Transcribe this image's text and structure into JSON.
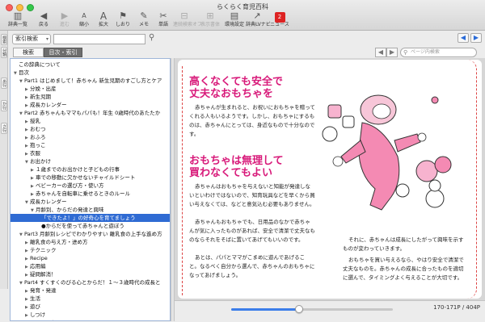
{
  "window": {
    "title": "らくらく育児百科"
  },
  "toolbar": {
    "buttons": [
      {
        "label": "辞典一覧",
        "icon": "book-list-icon",
        "glyph": "▥",
        "enabled": true
      },
      {
        "label": "戻る",
        "icon": "back-icon",
        "glyph": "◀",
        "enabled": true
      },
      {
        "label": "進む",
        "icon": "forward-icon",
        "glyph": "▶",
        "enabled": false
      },
      {
        "label": "縮小",
        "icon": "zoom-out-icon",
        "glyph": "A",
        "enabled": true
      },
      {
        "label": "拡大",
        "icon": "zoom-in-icon",
        "glyph": "A",
        "enabled": true
      },
      {
        "label": "しおり",
        "icon": "bookmark-icon",
        "glyph": "⚑",
        "enabled": true
      },
      {
        "label": "メモ",
        "icon": "memo-icon",
        "glyph": "✎",
        "enabled": true
      },
      {
        "label": "単語",
        "icon": "word-icon",
        "glyph": "✂",
        "enabled": true
      },
      {
        "label": "連続検索オフ",
        "icon": "continuous-search-icon",
        "glyph": "⊟",
        "enabled": false
      },
      {
        "label": "表示書体",
        "icon": "font-icon",
        "glyph": "⊞",
        "enabled": false
      },
      {
        "label": "環境設定",
        "icon": "settings-icon",
        "glyph": "▤",
        "enabled": true
      },
      {
        "label": "辞典LVナビ",
        "icon": "navi-icon",
        "glyph": "↗",
        "enabled": true
      },
      {
        "label": "ニュース",
        "icon": "news-icon",
        "glyph": "2",
        "enabled": true
      }
    ]
  },
  "search": {
    "mode": "索引検索",
    "query": ""
  },
  "tabs": {
    "search": "検索",
    "index": "目次・索引"
  },
  "page_search": {
    "placeholder": "ページ内検索"
  },
  "side_tabs": [
    "検索",
    "分類",
    "あ行",
    "か行",
    "さ行"
  ],
  "tree": [
    {
      "level": 0,
      "arrow": "",
      "text": "この辞典について",
      "selected": false
    },
    {
      "level": 0,
      "arrow": "▼",
      "text": "目次",
      "selected": false
    },
    {
      "level": 1,
      "arrow": "▼",
      "text": "Part1 はじめまして！赤ちゃん 新生児期のすごし方とケア",
      "selected": false
    },
    {
      "level": 2,
      "arrow": "▶",
      "text": "分娩・出産",
      "selected": false
    },
    {
      "level": 2,
      "arrow": "▶",
      "text": "新生児期",
      "selected": false
    },
    {
      "level": 2,
      "arrow": "▶",
      "text": "成長カレンダー",
      "selected": false
    },
    {
      "level": 1,
      "arrow": "▼",
      "text": "Part2 赤ちゃんもママもパパも！年生 0歳時代のあたたか",
      "selected": false
    },
    {
      "level": 2,
      "arrow": "▶",
      "text": "授乳",
      "selected": false
    },
    {
      "level": 2,
      "arrow": "▶",
      "text": "おむつ",
      "selected": false
    },
    {
      "level": 2,
      "arrow": "▶",
      "text": "おふろ",
      "selected": false
    },
    {
      "level": 2,
      "arrow": "▶",
      "text": "抱っこ",
      "selected": false
    },
    {
      "level": 2,
      "arrow": "▶",
      "text": "衣服",
      "selected": false
    },
    {
      "level": 2,
      "arrow": "▼",
      "text": "お出かけ",
      "selected": false
    },
    {
      "level": 3,
      "arrow": "▶",
      "text": "１歳までのお出かけと子どもの行事",
      "selected": false
    },
    {
      "level": 3,
      "arrow": "▶",
      "text": "車での移動に欠かせないチャイルドシート",
      "selected": false
    },
    {
      "level": 3,
      "arrow": "▶",
      "text": "ベビーカーの選び方・使い方",
      "selected": false
    },
    {
      "level": 3,
      "arrow": "▶",
      "text": "赤ちゃんを自転車に乗せるときのルール",
      "selected": false
    },
    {
      "level": 2,
      "arrow": "▼",
      "text": "成長カレンダー",
      "selected": false
    },
    {
      "level": 3,
      "arrow": "▼",
      "text": "月齢別、からだの発達と興味",
      "selected": false
    },
    {
      "level": 4,
      "arrow": "",
      "text": "「できたよ！」の好奇心を育てましょう",
      "selected": true
    },
    {
      "level": 4,
      "arrow": "",
      "text": "●からだを使って赤ちゃんと遊ぼう",
      "selected": false
    },
    {
      "level": 1,
      "arrow": "▼",
      "text": "Part3 月齢別レシピでわかりやすい 離乳食の上手な進め方",
      "selected": false
    },
    {
      "level": 2,
      "arrow": "▶",
      "text": "離乳食の与え方・进め方",
      "selected": false
    },
    {
      "level": 2,
      "arrow": "▶",
      "text": "テクニック",
      "selected": false
    },
    {
      "level": 2,
      "arrow": "▶",
      "text": "Recipe",
      "selected": false
    },
    {
      "level": 2,
      "arrow": "▶",
      "text": "応用編",
      "selected": false
    },
    {
      "level": 2,
      "arrow": "▶",
      "text": "疑問解消！",
      "selected": false
    },
    {
      "level": 1,
      "arrow": "▼",
      "text": "Part4 すくすくのびる心とからだ！１〜３歳時代の成長と",
      "selected": false
    },
    {
      "level": 2,
      "arrow": "▶",
      "text": "発育・発達",
      "selected": false
    },
    {
      "level": 2,
      "arrow": "▶",
      "text": "生活",
      "selected": false
    },
    {
      "level": 2,
      "arrow": "▶",
      "text": "遊び",
      "selected": false
    },
    {
      "level": 2,
      "arrow": "▶",
      "text": "しつけ",
      "selected": false
    },
    {
      "level": 2,
      "arrow": "▶",
      "text": "コミュニケーション",
      "selected": false
    }
  ],
  "page": {
    "heading1": [
      "高くなくても安全で",
      "丈夫なおもちゃを"
    ],
    "para1": "赤ちゃんが生まれると、お祝いにおもちゃを贈ってくれる人もいるようです。しかし、おもちゃにするものは、赤ちゃんにとっては、身近なもので十分なのです。",
    "heading2": [
      "おもちゃは無理して",
      "買わなくてもよい"
    ],
    "para2": "赤ちゃんはおもちゃを与えないと知能が発達しないといわけではないので、知育玩具などを早くから買い与えなくては、などと意気込む必要もありません。",
    "para3": "赤ちゃんもおもちゃでも、日用品のなかで赤ちゃんが気に入ったものがあれば、安全で清潔で丈夫なものならそれをそばに置いてあげてもいいのです。",
    "para4": "あとは、パパとママがこまめに遊んであげること。なるべく自分から選んで、赤ちゃんのおもちゃになってあげましょう。",
    "para5": "それに、赤ちゃんは成長にしたがって興味を示すものが変わっていきます。",
    "para6": "おもちゃを買い与えるなら、やはり安全で清潔で丈夫なものを。赤ちゃんの成長に合ったものを適切に選んで、タイミングよく与えることが大切です。"
  },
  "status": {
    "page_info": "170-171P / 404P",
    "slider_fraction": 0.42
  },
  "colors": {
    "accent": "#d81a7a",
    "selection": "#2f6bd3"
  }
}
